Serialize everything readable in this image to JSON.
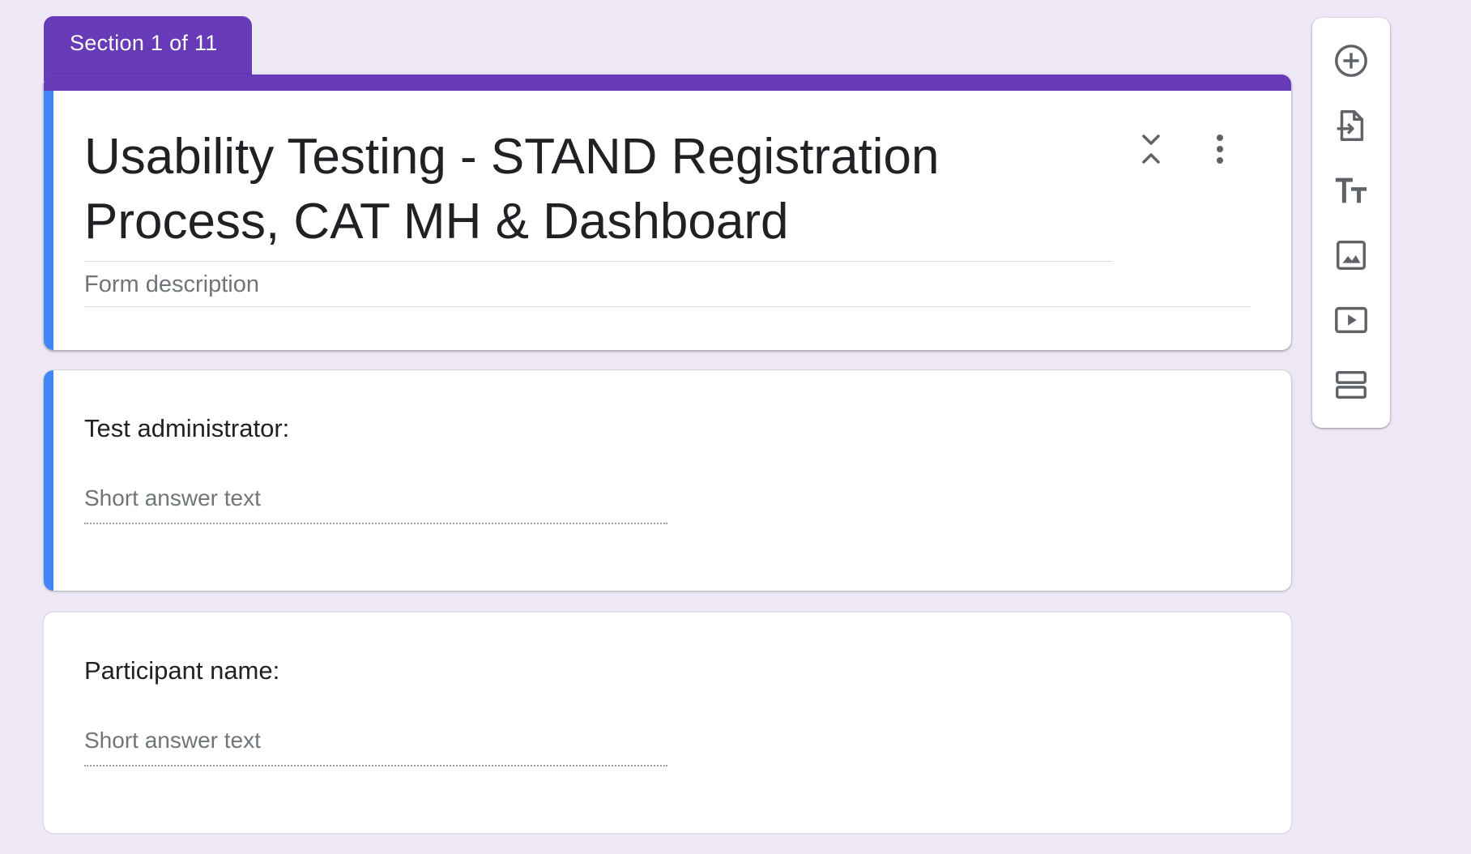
{
  "section_tab": {
    "label": "Section 1 of 11"
  },
  "form": {
    "title": "Usability Testing - STAND Registration Process, CAT MH & Dashboard",
    "description_placeholder": "Form description"
  },
  "questions": [
    {
      "label": "Test administrator:",
      "answer_placeholder": "Short answer text"
    },
    {
      "label": "Participant name:",
      "answer_placeholder": "Short answer text"
    }
  ],
  "toolbar": {
    "items": [
      {
        "icon": "add-circle-icon",
        "label": "Add question"
      },
      {
        "icon": "import-icon",
        "label": "Import questions"
      },
      {
        "icon": "title-text-icon",
        "label": "Add title and description"
      },
      {
        "icon": "image-icon",
        "label": "Add image"
      },
      {
        "icon": "video-icon",
        "label": "Add video"
      },
      {
        "icon": "section-icon",
        "label": "Add section"
      }
    ]
  },
  "colors": {
    "background": "#ede7f6",
    "accent_purple": "#673ab7",
    "active_blue": "#4285f4",
    "icon_gray": "#5f6368"
  }
}
